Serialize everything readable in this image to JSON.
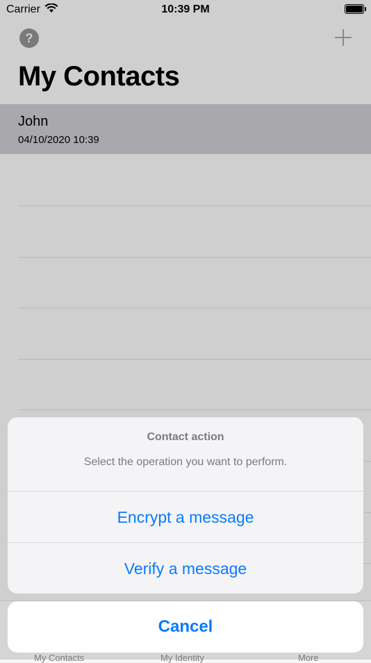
{
  "status": {
    "carrier": "Carrier",
    "time": "10:39 PM"
  },
  "header": {
    "title": "My Contacts"
  },
  "contacts": [
    {
      "name": "John",
      "date": "04/10/2020 10:39"
    }
  ],
  "tabs": [
    "My Contacts",
    "My Identity",
    "More"
  ],
  "action_sheet": {
    "title": "Contact action",
    "message": "Select the operation you want to perform.",
    "actions": [
      "Encrypt a message",
      "Verify a message"
    ],
    "cancel": "Cancel"
  },
  "colors": {
    "accent": "#0a7aff",
    "selected_row": "#a9a9ad",
    "dim_background": "#cfcfcf"
  }
}
